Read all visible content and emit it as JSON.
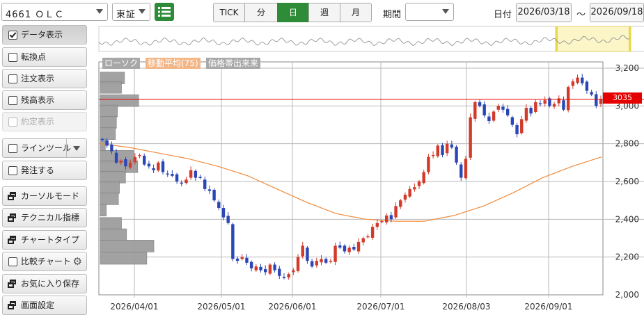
{
  "toolbar": {
    "symbol": "4661 ＯＬＣ",
    "market": "東証",
    "list_icon": "list-icon",
    "periods": [
      "TICK",
      "分",
      "日",
      "週",
      "月"
    ],
    "active_period": "日",
    "range_label": "期間",
    "range_value": "",
    "date_label": "日付",
    "date_from": "2026/03/18",
    "date_sep": "〜",
    "date_to": "2026/09/18"
  },
  "sidebar": {
    "items": [
      {
        "label": "データ表示",
        "kind": "check",
        "checked": true
      },
      {
        "label": "転換点",
        "kind": "check",
        "checked": false
      },
      {
        "label": "注文表示",
        "kind": "check",
        "checked": false
      },
      {
        "label": "残高表示",
        "kind": "check",
        "checked": false
      },
      {
        "label": "約定表示",
        "kind": "check",
        "checked": false,
        "disabled": true
      },
      {
        "label": "ラインツール",
        "kind": "check-dropdown",
        "checked": false
      },
      {
        "label": "発注する",
        "kind": "check",
        "checked": false
      },
      {
        "label": "カーソルモード",
        "kind": "window"
      },
      {
        "label": "テクニカル指標",
        "kind": "window"
      },
      {
        "label": "チャートタイプ",
        "kind": "window"
      },
      {
        "label": "比較チャート",
        "kind": "check-gear",
        "checked": false
      },
      {
        "label": "お気に入り保存",
        "kind": "window"
      },
      {
        "label": "画面設定",
        "kind": "window"
      }
    ]
  },
  "legend": {
    "candle": "ローソク",
    "ma": "移動平均(75)",
    "volume_profile": "価格帯出来来"
  },
  "current_price": "3035",
  "colors": {
    "up": "#d23a2a",
    "down": "#2b46b6",
    "ma": "#f08a3a",
    "price_line": "#e60000",
    "active": "#2e8b37"
  },
  "chart_data": {
    "type": "candlestick",
    "ylim": [
      2000,
      3250
    ],
    "y_ticks": [
      "3,200",
      "3,000",
      "2,800",
      "2,600",
      "2,400",
      "2,200",
      "2,000"
    ],
    "x_ticks": [
      "2026/04/01",
      "2026/05/01",
      "2026/06/01",
      "2026/07/01",
      "2026/08/03",
      "2026/09/01"
    ],
    "current_price": 3035,
    "close_approx": [
      2820,
      2790,
      2760,
      2700,
      2710,
      2680,
      2700,
      2730,
      2740,
      2690,
      2680,
      2660,
      2700,
      2650,
      2640,
      2630,
      2600,
      2590,
      2610,
      2660,
      2620,
      2620,
      2560,
      2550,
      2500,
      2460,
      2410,
      2380,
      2190,
      2180,
      2200,
      2170,
      2140,
      2150,
      2130,
      2120,
      2160,
      2130,
      2100,
      2090,
      2110,
      2130,
      2200,
      2260,
      2180,
      2150,
      2180,
      2190,
      2170,
      2180,
      2260,
      2250,
      2230,
      2250,
      2240,
      2280,
      2300,
      2310,
      2360,
      2380,
      2390,
      2420,
      2400,
      2470,
      2500,
      2530,
      2560,
      2570,
      2600,
      2650,
      2730,
      2740,
      2790,
      2740,
      2800,
      2780,
      2700,
      2620,
      2720,
      2940,
      3020,
      3000,
      2950,
      2920,
      2970,
      3000,
      2980,
      2950,
      2900,
      2850,
      2930,
      2990,
      2960,
      3020,
      3010,
      3030,
      3000,
      3010,
      3040,
      2980,
      3100,
      3130,
      3150,
      3120,
      3080,
      3060,
      3000,
      3035
    ],
    "ma75": {
      "name": "移動平均(75)",
      "approx": [
        2800,
        2780,
        2750,
        2720,
        2680,
        2630,
        2560,
        2490,
        2430,
        2400,
        2390,
        2390,
        2420,
        2470,
        2540,
        2620,
        2680,
        2730
      ]
    },
    "volume_profile": [
      {
        "price": 3150,
        "size": 0.24
      },
      {
        "price": 3100,
        "size": 0.21
      },
      {
        "price": 3030,
        "size": 0.38
      },
      {
        "price": 2975,
        "size": 0.17
      },
      {
        "price": 2915,
        "size": 0.16
      },
      {
        "price": 2855,
        "size": 0.15
      },
      {
        "price": 2795,
        "size": 0.05
      },
      {
        "price": 2735,
        "size": 0.33
      },
      {
        "price": 2680,
        "size": 0.37
      },
      {
        "price": 2625,
        "size": 0.25
      },
      {
        "price": 2570,
        "size": 0.19
      },
      {
        "price": 2510,
        "size": 0.18
      },
      {
        "price": 2450,
        "size": 0.06
      },
      {
        "price": 2380,
        "size": 0.21
      },
      {
        "price": 2320,
        "size": 0.26
      },
      {
        "price": 2260,
        "size": 0.53
      },
      {
        "price": 2195,
        "size": 0.46
      }
    ]
  }
}
